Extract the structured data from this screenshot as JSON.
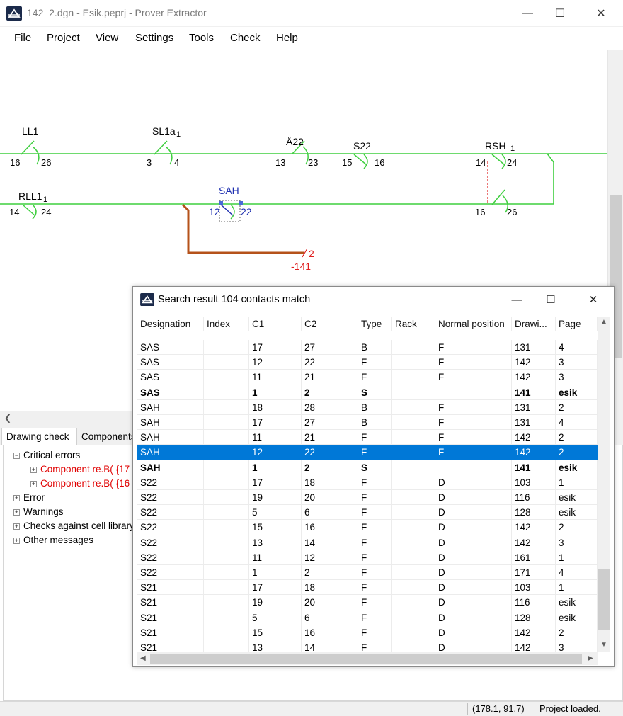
{
  "window": {
    "title": "142_2.dgn - Esik.peprj - Prover Extractor",
    "minimize": "—",
    "maximize": "☐",
    "close": "✕"
  },
  "menu": [
    "File",
    "Project",
    "View",
    "Settings",
    "Tools",
    "Check",
    "Help"
  ],
  "diagram": {
    "labels": {
      "ll1": "LL1",
      "sl1a": "SL1a",
      "sl1a_sub": "1",
      "a22": "Å22",
      "s22": "S22",
      "rsh": "RSH",
      "rsh_sub": "1",
      "rll1": "RLL1",
      "rll1_sub": "1",
      "sah": "SAH",
      "ll1_left": "16",
      "ll1_right": "26",
      "sl1a_left": "3",
      "sl1a_right": "4",
      "a22_left": "13",
      "a22_right": "23",
      "s22_left": "15",
      "s22_right": "16",
      "rsh_left": "14",
      "rsh_right": "24",
      "rll1_left": "14",
      "rll1_right": "24",
      "sah_left": "12",
      "sah_right": "22",
      "rsh2_left": "16",
      "rsh2_right": "26",
      "ref_top": "2",
      "ref_bottom": "-141"
    },
    "colors": {
      "wire": "#3fcf3f",
      "cable": "#b5521a",
      "selected": "#1e2fb0",
      "ref": "#e02020"
    }
  },
  "bottom_panel": {
    "tabs": [
      "Drawing check",
      "Components"
    ],
    "tree": {
      "critical": "Critical errors",
      "critical_children": [
        "Component re.B( {17",
        "Component re.B( {16"
      ],
      "error": "Error",
      "warnings": "Warnings",
      "cell_library": "Checks against cell library",
      "other": "Other messages"
    }
  },
  "status": {
    "coords": "(178.1, 91.7)",
    "message": "Project loaded."
  },
  "dialog": {
    "title": "Search result 104 contacts match",
    "columns": [
      "Designation",
      "Index",
      "C1",
      "C2",
      "Type",
      "Rack",
      "Normal position",
      "Drawi...",
      "Page"
    ],
    "rows": [
      [
        "SAS",
        "",
        "17",
        "27",
        "B",
        "",
        "F",
        "131",
        "4"
      ],
      [
        "SAS",
        "",
        "12",
        "22",
        "F",
        "",
        "F",
        "142",
        "3"
      ],
      [
        "SAS",
        "",
        "11",
        "21",
        "F",
        "",
        "F",
        "142",
        "3"
      ],
      [
        "SAS",
        "",
        "1",
        "2",
        "S",
        "",
        "",
        "141",
        "esik"
      ],
      [
        "SAH",
        "",
        "18",
        "28",
        "B",
        "",
        "F",
        "131",
        "2"
      ],
      [
        "SAH",
        "",
        "17",
        "27",
        "B",
        "",
        "F",
        "131",
        "4"
      ],
      [
        "SAH",
        "",
        "11",
        "21",
        "F",
        "",
        "F",
        "142",
        "2"
      ],
      [
        "SAH",
        "",
        "12",
        "22",
        "F",
        "",
        "F",
        "142",
        "2"
      ],
      [
        "SAH",
        "",
        "1",
        "2",
        "S",
        "",
        "",
        "141",
        "esik"
      ],
      [
        "S22",
        "",
        "17",
        "18",
        "F",
        "",
        "D",
        "103",
        "1"
      ],
      [
        "S22",
        "",
        "19",
        "20",
        "F",
        "",
        "D",
        "116",
        "esik"
      ],
      [
        "S22",
        "",
        "5",
        "6",
        "F",
        "",
        "D",
        "128",
        "esik"
      ],
      [
        "S22",
        "",
        "15",
        "16",
        "F",
        "",
        "D",
        "142",
        "2"
      ],
      [
        "S22",
        "",
        "13",
        "14",
        "F",
        "",
        "D",
        "142",
        "3"
      ],
      [
        "S22",
        "",
        "11",
        "12",
        "F",
        "",
        "D",
        "161",
        "1"
      ],
      [
        "S22",
        "",
        "1",
        "2",
        "F",
        "",
        "D",
        "171",
        "4"
      ],
      [
        "S21",
        "",
        "17",
        "18",
        "F",
        "",
        "D",
        "103",
        "1"
      ],
      [
        "S21",
        "",
        "19",
        "20",
        "F",
        "",
        "D",
        "116",
        "esik"
      ],
      [
        "S21",
        "",
        "5",
        "6",
        "F",
        "",
        "D",
        "128",
        "esik"
      ],
      [
        "S21",
        "",
        "15",
        "16",
        "F",
        "",
        "D",
        "142",
        "2"
      ],
      [
        "S21",
        "",
        "13",
        "14",
        "F",
        "",
        "D",
        "142",
        "3"
      ]
    ],
    "bold_rows": [
      3,
      8
    ],
    "selected_row": 7,
    "selection_color": "#0078d7"
  }
}
